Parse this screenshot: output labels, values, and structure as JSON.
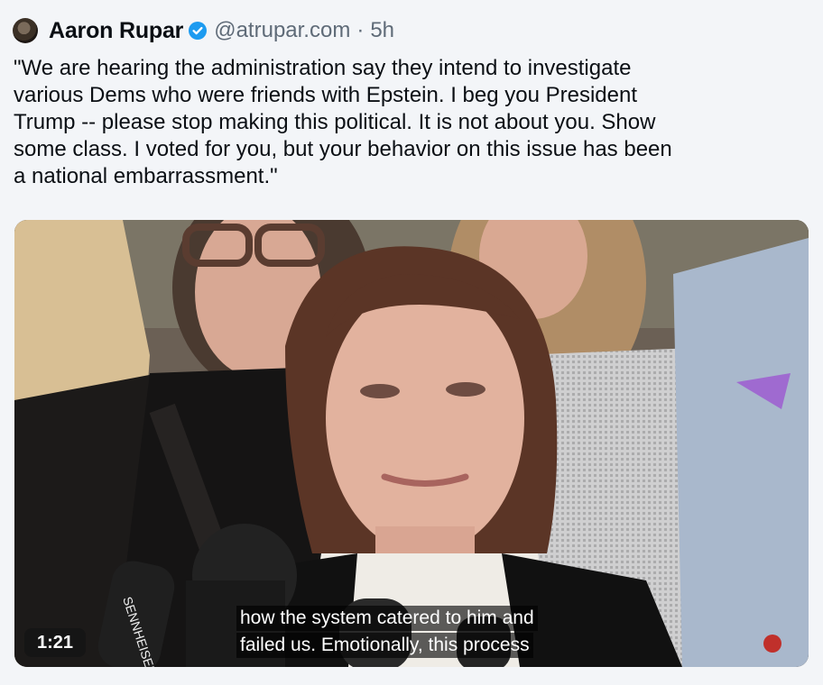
{
  "post": {
    "author_name": "Aaron Rupar",
    "handle": "@atrupar.com",
    "separator": "·",
    "time_ago": "5h",
    "text": "\"We are hearing the administration say they intend to investigate\nvarious Dems who were friends with Epstein. I beg you President\nTrump -- please stop making this political. It is not about you. Show\nsome class. I voted for you, but your behavior on this issue has been\na national embarrassment.\""
  },
  "video": {
    "duration": "1:21",
    "caption_line1": "how the system catered to him and",
    "caption_line2": "failed us. Emotionally, this process",
    "mic_brand": "SENNHEISER"
  },
  "colors": {
    "verified": "#1d9bf0",
    "text": "#0b0f14",
    "muted": "#5f6b78",
    "background": "#f3f5f8"
  }
}
